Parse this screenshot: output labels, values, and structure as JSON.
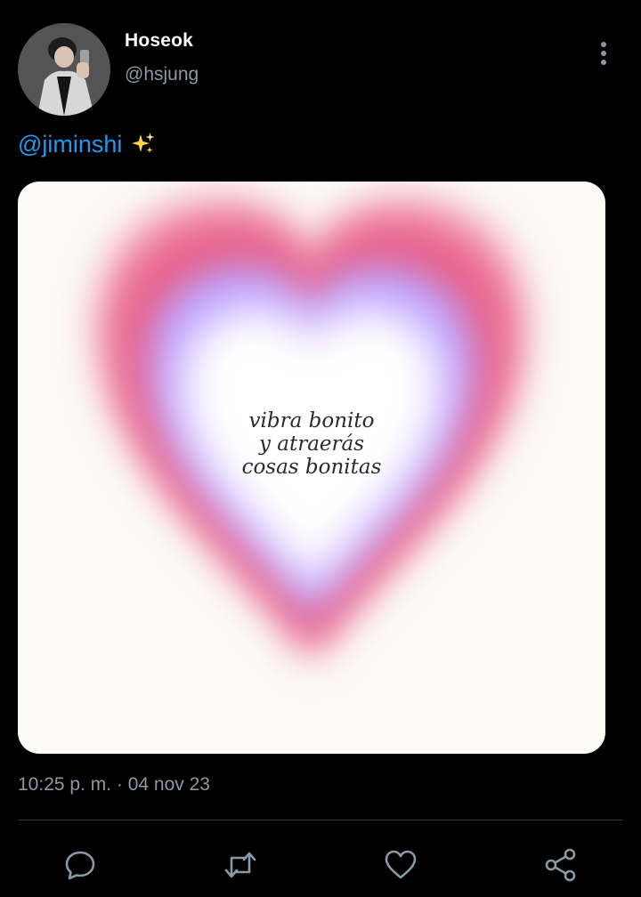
{
  "user": {
    "name": "Hoseok",
    "handle": "@hsjung"
  },
  "tweet": {
    "mention": "@jiminshi",
    "emoji_icon": "sparkles-icon",
    "image_text": {
      "line1": "vibra bonito",
      "line2": "y atraerás",
      "line3": "cosas bonitas"
    },
    "timestamp": "10:25 p. m. · 04 nov 23"
  },
  "actions": [
    "reply-icon",
    "retweet-icon",
    "like-icon",
    "share-icon"
  ],
  "colors": {
    "background": "#000000",
    "mention": "#1d9bf0",
    "secondary_text": "#8b98a5",
    "divider": "#2f3336",
    "heart_outer": "#ee6a8a",
    "heart_inner": "#b49cff"
  }
}
